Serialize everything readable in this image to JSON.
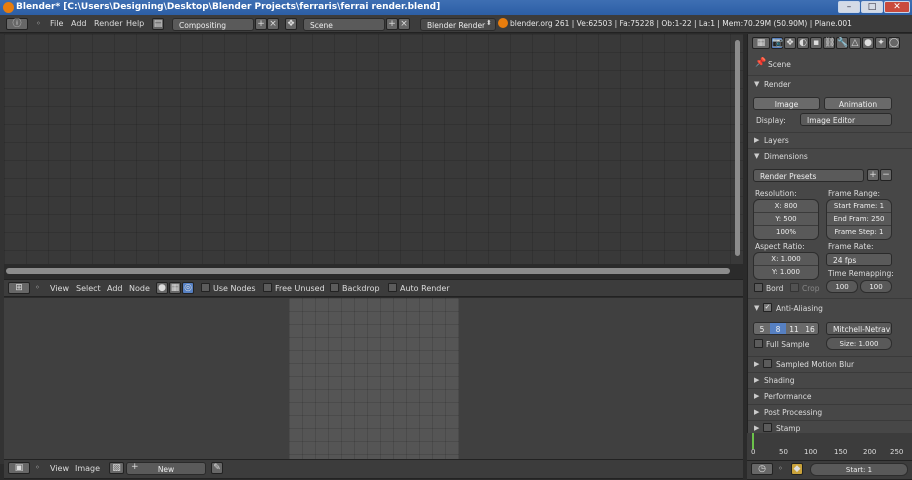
{
  "window": {
    "title": "Blender* [C:\\Users\\Designing\\Desktop\\Blender Projects\\ferraris\\ferrai render.blend]"
  },
  "topbar": {
    "menus": [
      "File",
      "Add",
      "Render",
      "Help"
    ],
    "layout": "Compositing",
    "scene": "Scene",
    "engine": "Blender Render",
    "stats": "blender.org 261 | Ve:62503 | Fa:75228 | Ob:1-22 | La:1 | Mem:70.29M (50.90M) | Plane.001"
  },
  "node_header": {
    "menus": [
      "View",
      "Select",
      "Add",
      "Node"
    ],
    "use_nodes": "Use Nodes",
    "free_unused": "Free Unused",
    "backdrop": "Backdrop",
    "auto_render": "Auto Render"
  },
  "image_header": {
    "menus": [
      "View",
      "Image"
    ],
    "new_label": "New"
  },
  "props": {
    "breadcrumb": "Scene",
    "render": {
      "title": "Render",
      "image_btn": "Image",
      "animation_btn": "Animation",
      "display_label": "Display:",
      "display_value": "Image Editor"
    },
    "layers": "Layers",
    "dimensions": {
      "title": "Dimensions",
      "presets": "Render Presets",
      "resolution_label": "Resolution:",
      "x": "X: 800",
      "y": "Y: 500",
      "pct": "100%",
      "frame_range_label": "Frame Range:",
      "start": "Start Frame: 1",
      "end": "End Fram: 250",
      "step": "Frame Step: 1",
      "aspect_label": "Aspect Ratio:",
      "ax": "X: 1.000",
      "ay": "Y: 1.000",
      "frame_rate_label": "Frame Rate:",
      "fps": "24 fps",
      "remap_label": "Time Remapping:",
      "remap_old": "100",
      "remap_new": "100",
      "bord": "Bord",
      "crop": "Crop"
    },
    "aa": {
      "title": "Anti-Aliasing",
      "samples": [
        "5",
        "8",
        "11",
        "16"
      ],
      "filter": "Mitchell-Netrav",
      "full_sample": "Full Sample",
      "size": "Size: 1.000"
    },
    "panels": [
      "Sampled Motion Blur",
      "Shading",
      "Performance",
      "Post Processing",
      "Stamp"
    ]
  },
  "timeline": {
    "ticks": [
      "0",
      "50",
      "100",
      "150",
      "200",
      "250"
    ],
    "start": "Start: 1"
  },
  "colors": {
    "accent": "#5680c2",
    "titlebar": "#3467af",
    "bg": "#474747"
  }
}
